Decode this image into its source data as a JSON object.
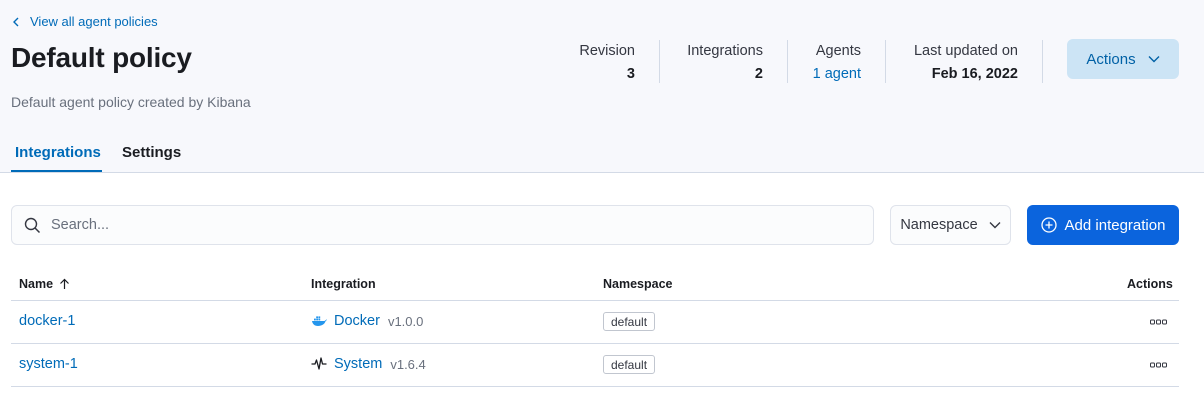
{
  "header": {
    "back_link": "View all agent policies",
    "title": "Default policy",
    "description": "Default agent policy created by Kibana",
    "stats": {
      "revision": {
        "label": "Revision",
        "value": "3"
      },
      "integrations": {
        "label": "Integrations",
        "value": "2"
      },
      "agents": {
        "label": "Agents",
        "value": "1 agent"
      },
      "last_updated": {
        "label": "Last updated on",
        "value": "Feb 16, 2022"
      }
    },
    "actions_label": "Actions"
  },
  "tabs": [
    {
      "label": "Integrations",
      "active": true
    },
    {
      "label": "Settings",
      "active": false
    }
  ],
  "toolbar": {
    "search_placeholder": "Search...",
    "namespace_filter_label": "Namespace",
    "add_integration_label": "Add integration"
  },
  "table": {
    "columns": {
      "name": "Name",
      "integration": "Integration",
      "namespace": "Namespace",
      "actions": "Actions"
    },
    "sort": {
      "column": "name",
      "direction": "ascending"
    },
    "rows": [
      {
        "name": "docker-1",
        "integration": "Docker",
        "icon": "docker-icon",
        "version": "v1.0.0",
        "namespace": "default"
      },
      {
        "name": "system-1",
        "integration": "System",
        "icon": "system-heartbeat-icon",
        "version": "v1.6.4",
        "namespace": "default"
      }
    ]
  },
  "colors": {
    "accent": "#006bb8",
    "primary_button": "#0b64dd",
    "header_bg": "#f7f8fc",
    "docker_blue": "#2496ed"
  }
}
